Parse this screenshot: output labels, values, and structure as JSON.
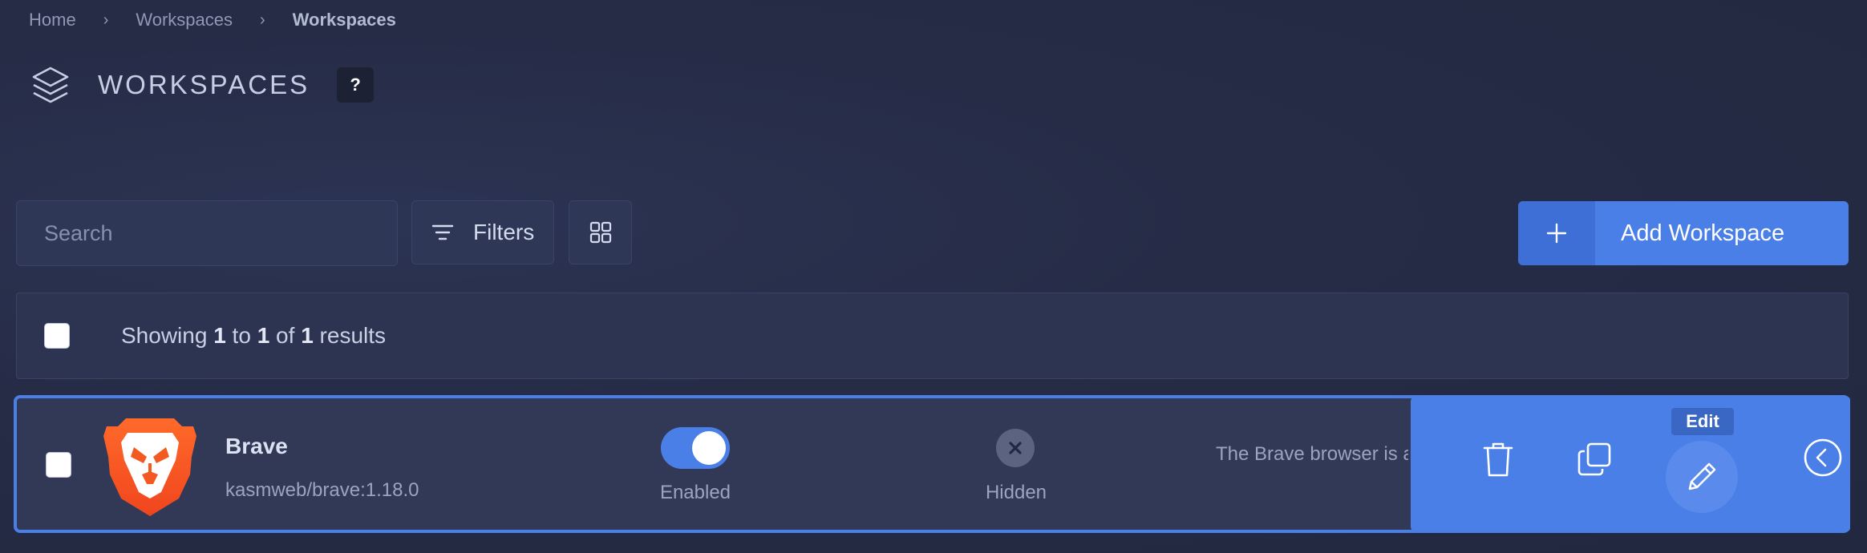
{
  "breadcrumb": {
    "home": "Home",
    "parent": "Workspaces",
    "current": "Workspaces"
  },
  "header": {
    "title": "WORKSPACES",
    "help": "?"
  },
  "toolbar": {
    "search_placeholder": "Search",
    "filters_label": "Filters",
    "add_label": "Add Workspace"
  },
  "results": {
    "prefix": "Showing",
    "from": "1",
    "to_word": "to",
    "to": "1",
    "of_word": "of",
    "total": "1",
    "suffix": "results"
  },
  "workspace": {
    "name": "Brave",
    "image": "kasmweb/brave:1.18.0",
    "enabled_label": "Enabled",
    "enabled": true,
    "hidden_label": "Hidden",
    "description": "The Brave browser is a"
  },
  "actions": {
    "edit_tooltip": "Edit"
  },
  "icons": [
    "chevron-right-icon",
    "layers-icon",
    "filter-icon",
    "grid-icon",
    "plus-icon",
    "brave-lion-icon",
    "close-icon",
    "trash-icon",
    "copy-icon",
    "pencil-icon",
    "chevron-left-circle-icon"
  ],
  "colors": {
    "accent": "#4a7fe8",
    "background": "#262c46",
    "brave_orange": "#f25a22"
  }
}
